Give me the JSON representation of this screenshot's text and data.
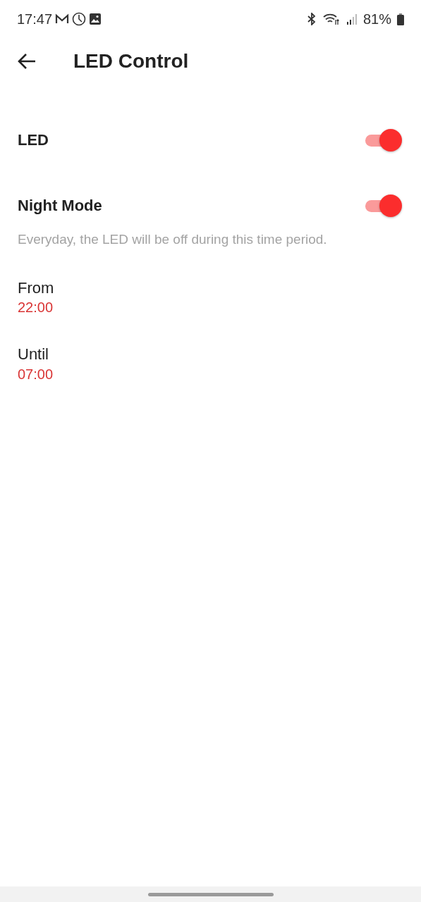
{
  "status_bar": {
    "time": "17:47",
    "battery": "81%"
  },
  "app_bar": {
    "title": "LED Control"
  },
  "items": [
    {
      "kind": "switch",
      "label": "LED",
      "on": true
    },
    {
      "kind": "switch",
      "label": "Night Mode",
      "on": true
    },
    {
      "kind": "note",
      "text": "Everyday, the LED will be off during this time period."
    },
    {
      "kind": "time",
      "label": "From",
      "value": "22:00"
    },
    {
      "kind": "time",
      "label": "Until",
      "value": "07:00"
    }
  ]
}
